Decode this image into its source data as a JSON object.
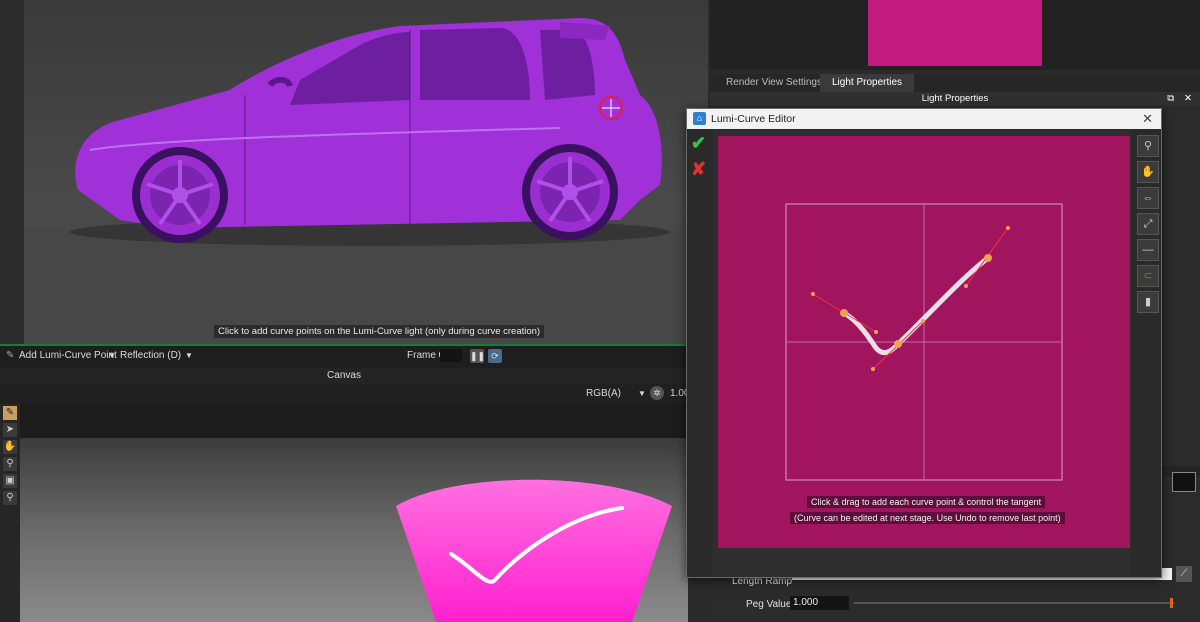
{
  "viewport": {
    "hint": "Click to add curve points on the Lumi-Curve light (only during curve creation)"
  },
  "vp_toolbar": {
    "tool_label": "Add Lumi-Curve Point",
    "mode_label": "Reflection (D)",
    "frame_label": "Frame 0"
  },
  "canvas": {
    "title": "Canvas",
    "channel": "RGB(A)",
    "value": "1.00"
  },
  "right_panel": {
    "tabs": [
      "Render View Settings",
      "Light Properties"
    ],
    "active_tab": "Light Properties",
    "panel_title": "Light Properties",
    "length_ramp_label": "Length Ramp",
    "peg_value_label": "Peg Value",
    "peg_value": "1.000"
  },
  "dialog": {
    "title": "Lumi-Curve Editor",
    "instruction_1": "Click & drag to add each curve point & control the tangent",
    "instruction_2": "(Curve can be edited at next stage. Use Undo to remove last point)"
  },
  "colors": {
    "accent_magenta": "#c21a7e",
    "editor_bg": "#a1155f",
    "car": "#a030d8",
    "ok_green": "#3cc04a",
    "cancel_red": "#e03030",
    "curve_point": "#f0a050"
  },
  "icons": {
    "ok": "checkmark-icon",
    "cancel": "x-icon",
    "zoom": "magnifier-icon",
    "pan": "hand-icon"
  }
}
